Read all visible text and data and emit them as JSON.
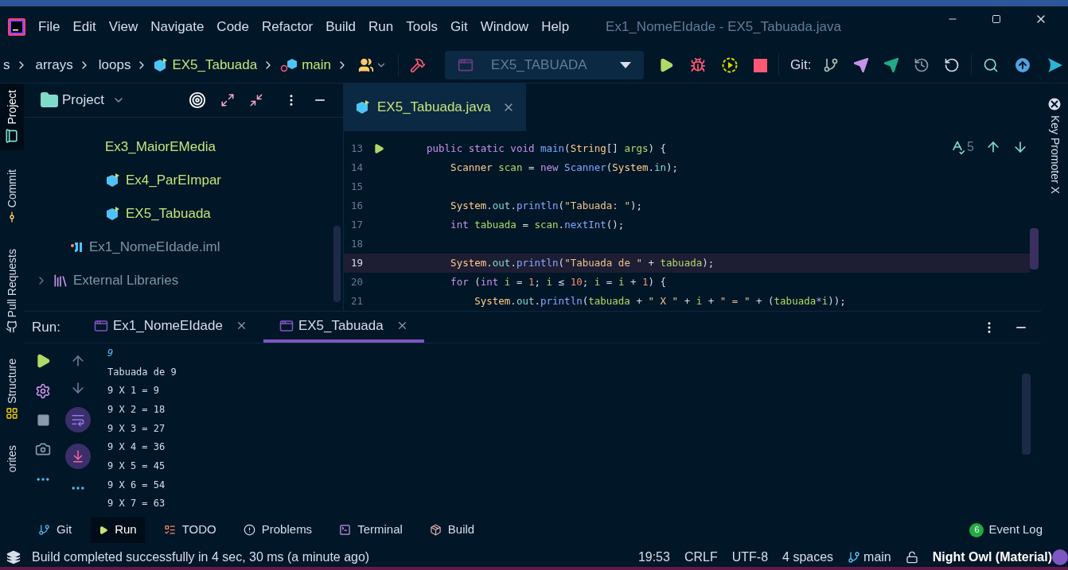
{
  "title_bar": {
    "menus": [
      "File",
      "Edit",
      "View",
      "Navigate",
      "Code",
      "Refactor",
      "Build",
      "Run",
      "Tools",
      "Git",
      "Window",
      "Help"
    ],
    "title": "Ex1_NomeEIdade - EX5_Tabuada.java"
  },
  "toolbar": {
    "breadcrumbs": [
      {
        "text": "s",
        "kind": "folder"
      },
      {
        "text": "arrays",
        "kind": "folder"
      },
      {
        "text": "loops",
        "kind": "folder"
      },
      {
        "text": "EX5_Tabuada",
        "kind": "class"
      },
      {
        "text": "main",
        "kind": "method"
      }
    ],
    "run_config": "EX5_TABUADA",
    "git_label": "Git:"
  },
  "left_tool_tabs": [
    {
      "label": "Project",
      "kind": "project",
      "selected": true
    },
    {
      "label": "Commit",
      "kind": "commit",
      "selected": false
    },
    {
      "label": "Pull Requests",
      "kind": "pull_requests",
      "selected": false
    },
    {
      "label": "Structure",
      "kind": "structure",
      "selected": false
    },
    {
      "label": "orites",
      "kind": "favorites",
      "selected": false
    }
  ],
  "project": {
    "title": "Project",
    "items": [
      {
        "label": "Ex3_MaiorEMedia",
        "kind": "source"
      },
      {
        "label": "Ex4_ParEImpar",
        "kind": "class"
      },
      {
        "label": "EX5_Tabuada",
        "kind": "class"
      },
      {
        "label": "Ex1_NomeEIdade.iml",
        "kind": "module"
      },
      {
        "label": "External Libraries",
        "kind": "library",
        "expanded": false
      }
    ]
  },
  "editor": {
    "tabs": [
      {
        "label": "EX5_Tabuada.java",
        "selected": true
      }
    ],
    "problems_count": "5",
    "lines": [
      {
        "number": "13",
        "current": false,
        "runnable": true,
        "tokens": [
          {
            "text": "public static void ",
            "kind": "keyword"
          },
          {
            "text": "main",
            "kind": "method"
          },
          {
            "text": "(",
            "kind": "plain"
          },
          {
            "text": "String",
            "kind": "type"
          },
          {
            "text": "[] ",
            "kind": "plain"
          },
          {
            "text": "args",
            "kind": "var"
          },
          {
            "text": ") {",
            "kind": "plain"
          }
        ]
      },
      {
        "number": "14",
        "current": false,
        "runnable": false,
        "tokens": [
          {
            "text": "    Scanner ",
            "kind": "type"
          },
          {
            "text": "scan",
            "kind": "var"
          },
          {
            "text": " = ",
            "kind": "plain"
          },
          {
            "text": "new ",
            "kind": "keyword"
          },
          {
            "text": "Scanner",
            "kind": "method"
          },
          {
            "text": "(",
            "kind": "plain"
          },
          {
            "text": "System",
            "kind": "type"
          },
          {
            "text": ".",
            "kind": "plain"
          },
          {
            "text": "in",
            "kind": "field"
          },
          {
            "text": ");",
            "kind": "plain"
          }
        ]
      },
      {
        "number": "15",
        "current": false,
        "runnable": false
      },
      {
        "number": "16",
        "current": false,
        "runnable": false,
        "tokens": [
          {
            "text": "    System",
            "kind": "type"
          },
          {
            "text": ".",
            "kind": "plain"
          },
          {
            "text": "out",
            "kind": "field"
          },
          {
            "text": ".",
            "kind": "plain"
          },
          {
            "text": "println",
            "kind": "method"
          },
          {
            "text": "(",
            "kind": "plain"
          },
          {
            "text": "\"Tabuada: \"",
            "kind": "string"
          },
          {
            "text": ");",
            "kind": "plain"
          }
        ]
      },
      {
        "number": "17",
        "current": false,
        "runnable": false,
        "tokens": [
          {
            "text": "    int ",
            "kind": "keyword"
          },
          {
            "text": "tabuada",
            "kind": "var"
          },
          {
            "text": " = ",
            "kind": "plain"
          },
          {
            "text": "scan",
            "kind": "var"
          },
          {
            "text": ".",
            "kind": "plain"
          },
          {
            "text": "nextInt",
            "kind": "method"
          },
          {
            "text": "();",
            "kind": "plain"
          }
        ]
      },
      {
        "number": "18",
        "current": false,
        "runnable": false
      },
      {
        "number": "19",
        "current": true,
        "runnable": false,
        "tokens": [
          {
            "text": "    System",
            "kind": "type"
          },
          {
            "text": ".",
            "kind": "plain"
          },
          {
            "text": "out",
            "kind": "field"
          },
          {
            "text": ".",
            "kind": "plain"
          },
          {
            "text": "println",
            "kind": "method"
          },
          {
            "text": "(",
            "kind": "plain"
          },
          {
            "text": "\"Tabuada de \"",
            "kind": "string"
          },
          {
            "text": " + ",
            "kind": "plain"
          },
          {
            "text": "tabuada",
            "kind": "var"
          },
          {
            "text": ");",
            "kind": "plain"
          }
        ]
      },
      {
        "number": "20",
        "current": false,
        "runnable": false,
        "tokens": [
          {
            "text": "    for ",
            "kind": "keyword"
          },
          {
            "text": "(",
            "kind": "plain"
          },
          {
            "text": "int ",
            "kind": "keyword"
          },
          {
            "text": "i",
            "kind": "var"
          },
          {
            "text": " = ",
            "kind": "plain"
          },
          {
            "text": "1",
            "kind": "number"
          },
          {
            "text": "; ",
            "kind": "plain"
          },
          {
            "text": "i",
            "kind": "var"
          },
          {
            "text": " ≤ ",
            "kind": "plain"
          },
          {
            "text": "10",
            "kind": "number"
          },
          {
            "text": "; ",
            "kind": "plain"
          },
          {
            "text": "i",
            "kind": "var"
          },
          {
            "text": " = ",
            "kind": "plain"
          },
          {
            "text": "i",
            "kind": "var"
          },
          {
            "text": " + ",
            "kind": "plain"
          },
          {
            "text": "1",
            "kind": "number"
          },
          {
            "text": ") {",
            "kind": "plain"
          }
        ]
      },
      {
        "number": "21",
        "current": false,
        "runnable": false,
        "tokens": [
          {
            "text": "        System",
            "kind": "type"
          },
          {
            "text": ".",
            "kind": "plain"
          },
          {
            "text": "out",
            "kind": "field"
          },
          {
            "text": ".",
            "kind": "plain"
          },
          {
            "text": "println",
            "kind": "method"
          },
          {
            "text": "(",
            "kind": "plain"
          },
          {
            "text": "tabuada",
            "kind": "var"
          },
          {
            "text": " + ",
            "kind": "plain"
          },
          {
            "text": "\" X \"",
            "kind": "string"
          },
          {
            "text": " + ",
            "kind": "plain"
          },
          {
            "text": "i",
            "kind": "var"
          },
          {
            "text": " + ",
            "kind": "plain"
          },
          {
            "text": "\" = \"",
            "kind": "string"
          },
          {
            "text": " + (",
            "kind": "plain"
          },
          {
            "text": "tabuada",
            "kind": "var"
          },
          {
            "text": "*",
            "kind": "keyword"
          },
          {
            "text": "i",
            "kind": "var"
          },
          {
            "text": "));",
            "kind": "plain"
          }
        ]
      }
    ]
  },
  "right_tool_tabs": [
    {
      "label": "Key Promoter X"
    }
  ],
  "run": {
    "label": "Run:",
    "tabs": [
      {
        "label": "Ex1_NomeEIdade",
        "selected": false
      },
      {
        "label": "EX5_Tabuada",
        "selected": true
      }
    ],
    "output": [
      {
        "text": "9",
        "kind": "input"
      },
      {
        "text": "Tabuada de 9",
        "kind": "output"
      },
      {
        "text": "9 X 1 = 9",
        "kind": "output"
      },
      {
        "text": "9 X 2 = 18",
        "kind": "output"
      },
      {
        "text": "9 X 3 = 27",
        "kind": "output"
      },
      {
        "text": "9 X 4 = 36",
        "kind": "output"
      },
      {
        "text": "9 X 5 = 45",
        "kind": "output"
      },
      {
        "text": "9 X 6 = 54",
        "kind": "output"
      },
      {
        "text": "9 X 7 = 63",
        "kind": "output"
      }
    ]
  },
  "bottom_tabs": [
    {
      "label": "Git",
      "kind": "git",
      "selected": false
    },
    {
      "label": "Run",
      "kind": "run",
      "selected": true
    },
    {
      "label": "TODO",
      "kind": "todo",
      "selected": false
    },
    {
      "label": "Problems",
      "kind": "problems",
      "selected": false
    },
    {
      "label": "Terminal",
      "kind": "terminal",
      "selected": false
    },
    {
      "label": "Build",
      "kind": "build",
      "selected": false
    }
  ],
  "event_log": {
    "label": "Event Log",
    "count": "6"
  },
  "status_bar": {
    "message": "Build completed successfully in 4 sec, 30 ms (a minute ago)",
    "items": [
      "19:53",
      "CRLF",
      "UTF-8",
      "4 spaces"
    ],
    "branch": "main",
    "theme": "Night Owl (Material)"
  }
}
